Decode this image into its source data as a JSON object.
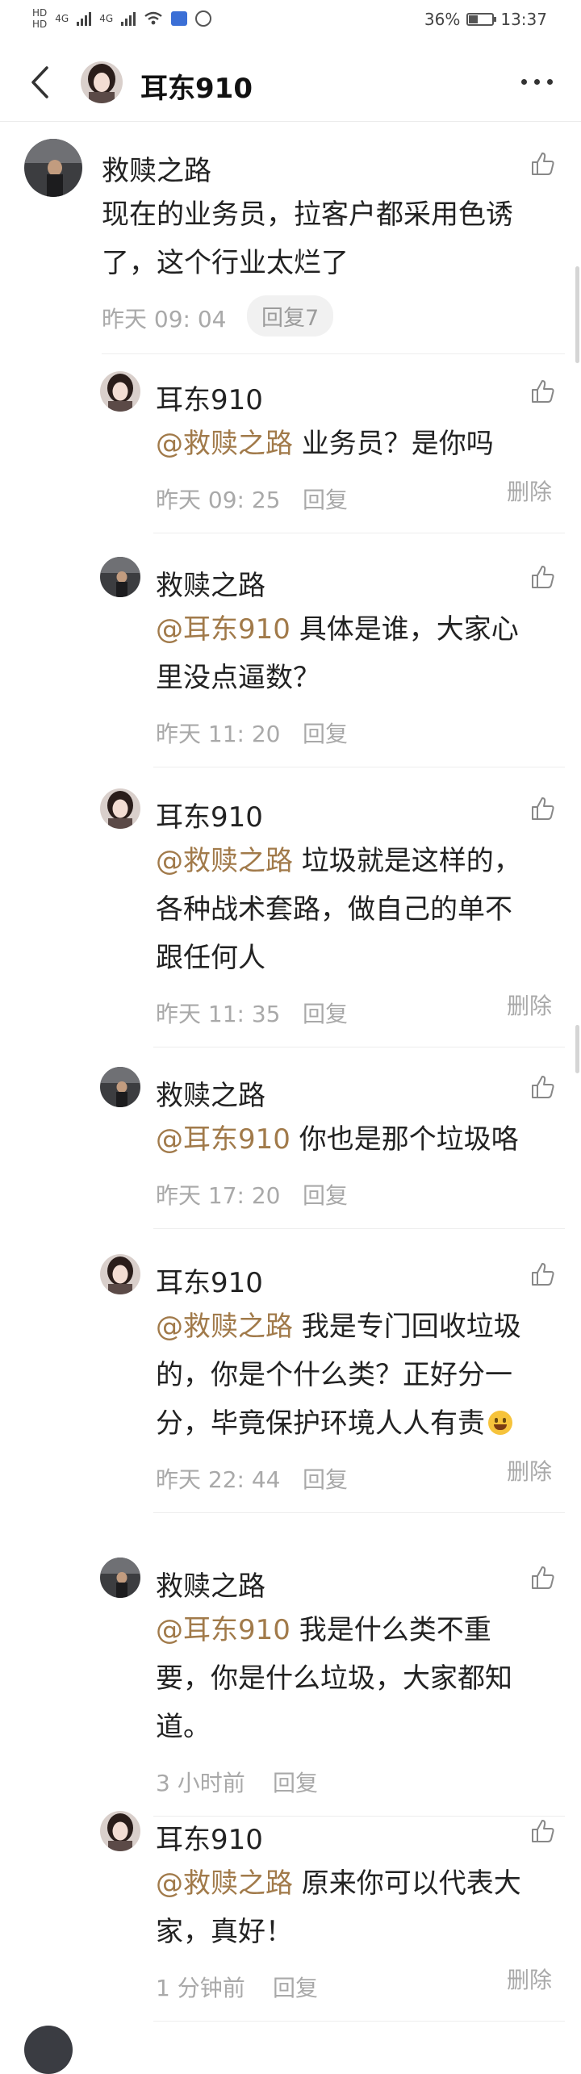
{
  "status_bar": {
    "hd1": "HD",
    "hd2": "HD",
    "net1": "4G",
    "net2": "4G",
    "battery_percent": "36%",
    "battery_level": 0.36,
    "time": "13:37"
  },
  "header": {
    "title": "耳东910",
    "back_icon": "chevron-left-icon",
    "more_icon": "more-dots-icon"
  },
  "main_comment": {
    "author": "救赎之路",
    "text": "现在的业务员，拉客户都采用色诱了，这个行业太烂了",
    "text_line1": "现在的业务员，拉客户都采用色诱",
    "text_line2": "了，这个行业太烂了",
    "time": "昨天 09: 04",
    "reply_count_label": "回复7"
  },
  "replies": [
    {
      "author": "耳东910",
      "mention": "@救赎之路",
      "text_lines": [
        " 业务员？是你吗"
      ],
      "time": "昨天 09: 25",
      "reply_label": "回复",
      "delete_label": "删除"
    },
    {
      "author": "救赎之路",
      "mention": "@耳东910",
      "text_lines": [
        " 具体是谁，大家心",
        "里没点逼数？"
      ],
      "time": "昨天 11: 20",
      "reply_label": "回复"
    },
    {
      "author": "耳东910",
      "mention": "@救赎之路",
      "text_lines": [
        " 垃圾就是这样的，",
        "各种战术套路，做自己的单不",
        "跟任何人"
      ],
      "time": "昨天 11: 35",
      "reply_label": "回复",
      "delete_label": "删除"
    },
    {
      "author": "救赎之路",
      "mention": "@耳东910",
      "text_lines": [
        " 你也是那个垃圾咯"
      ],
      "time": "昨天 17: 20",
      "reply_label": "回复"
    },
    {
      "author": "耳东910",
      "mention": "@救赎之路",
      "text_lines": [
        " 我是专门回收垃圾",
        "的，你是个什么类？正好分一",
        "分，毕竟保护环境人人有责"
      ],
      "time": "昨天 22: 44",
      "reply_label": "回复",
      "delete_label": "删除"
    },
    {
      "author": "救赎之路",
      "mention": "@耳东910",
      "text_lines": [
        " 我是什么类不重",
        "要，你是什么垃圾，大家都知",
        "道。"
      ],
      "time": "3 小时前",
      "reply_label": "回复"
    },
    {
      "author": "耳东910",
      "mention": "@救赎之路",
      "text_lines": [
        " 原来你可以代表大",
        "家，真好！"
      ],
      "time": "1 分钟前",
      "reply_label": "回复",
      "delete_label": "删除"
    }
  ],
  "colors": {
    "mention": "#a17a4a",
    "meta": "#a9a9a9",
    "text": "#222222"
  }
}
